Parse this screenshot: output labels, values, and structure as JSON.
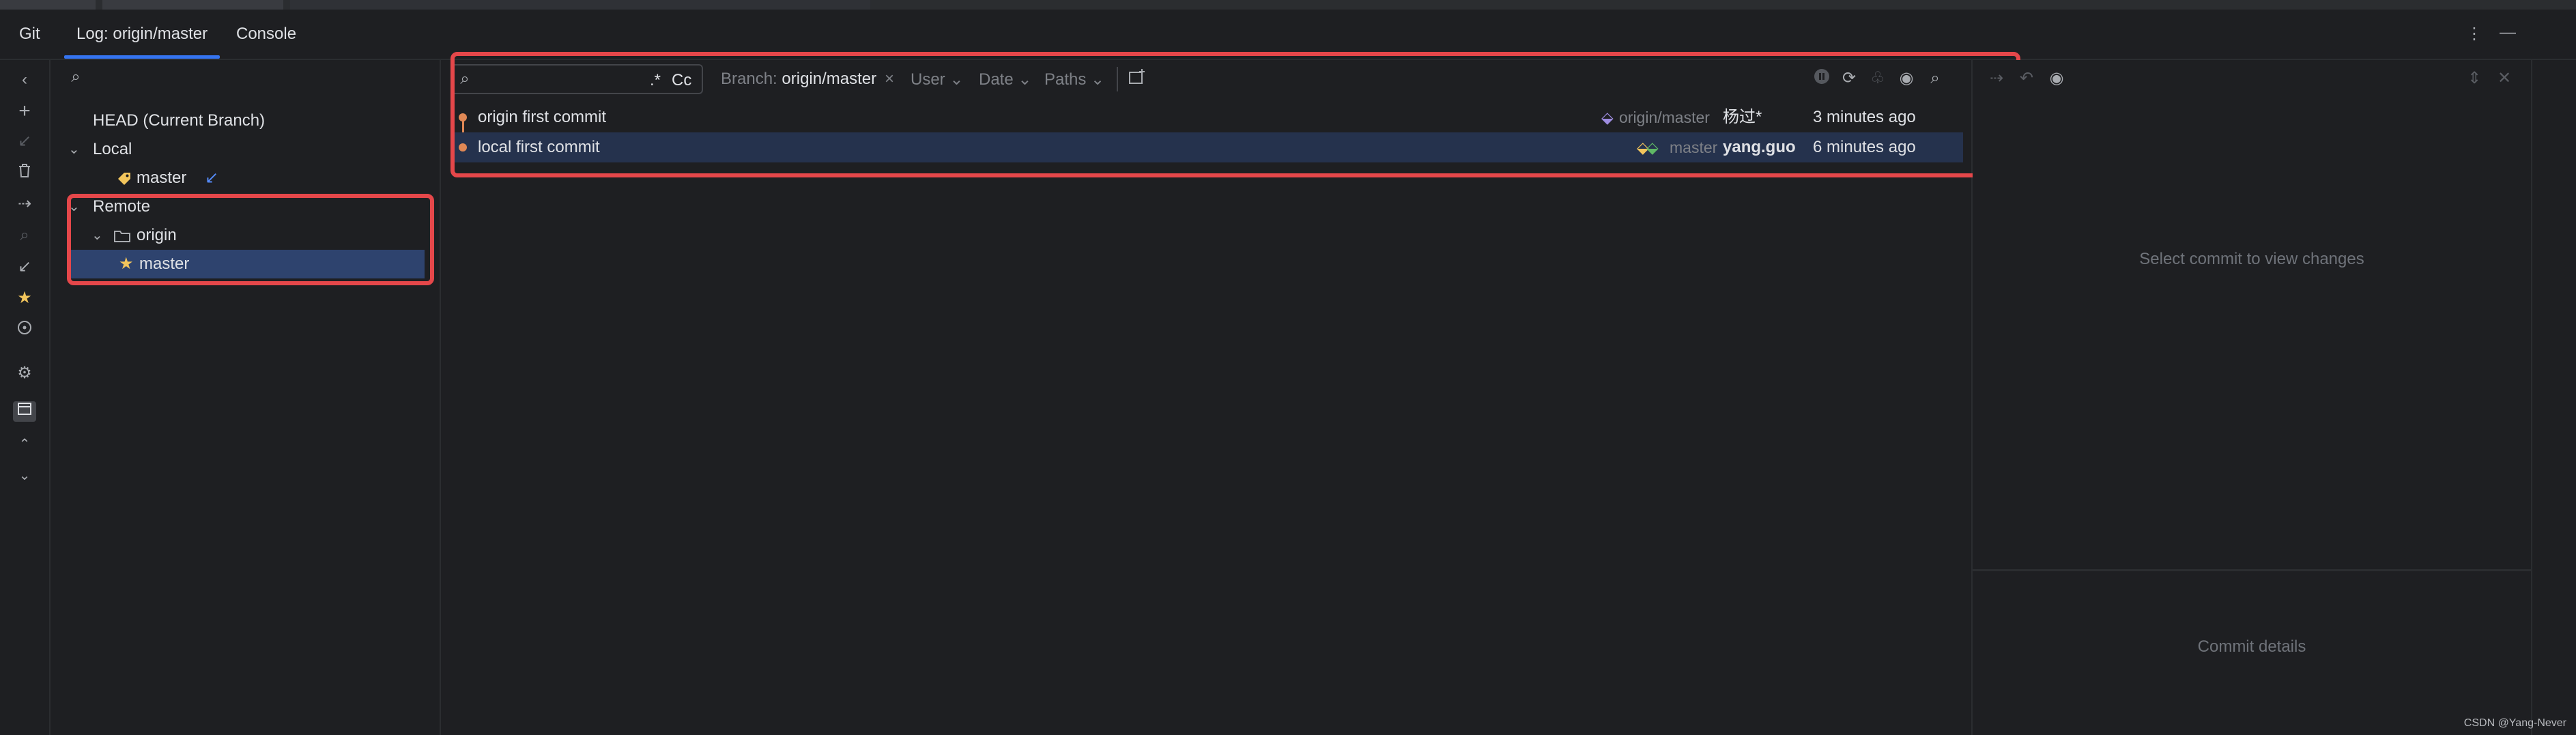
{
  "tabs": [
    {
      "label": "Git"
    },
    {
      "label": "Log: origin/master"
    },
    {
      "label": "Console"
    }
  ],
  "left_toolbar_icons": [
    "chevron-left-icon",
    "plus-icon",
    "update-arrow-icon",
    "trash-icon",
    "merge-icon",
    "search-icon",
    "checkout-icon",
    "star-icon",
    "compass-icon",
    "settings-icon",
    "preview-icon",
    "expand-icon",
    "collapse-icon"
  ],
  "branch_tree": {
    "head": "HEAD (Current Branch)",
    "local_label": "Local",
    "local_master": "master",
    "remote_label": "Remote",
    "origin_label": "origin",
    "remote_master": "master"
  },
  "log": {
    "search_value": "",
    "regex_label": ".*",
    "case_label": "Cc",
    "branch_filter_label": "Branch:",
    "branch_filter_value": "origin/master",
    "user_filter": "User",
    "date_filter": "Date",
    "paths_filter": "Paths",
    "commits": [
      {
        "message": "origin first commit",
        "ref": "origin/master",
        "author": "杨过*",
        "date": "3 minutes ago"
      },
      {
        "message": "local first commit",
        "ref": "master",
        "author": "yang.guo",
        "date": "6 minutes ago"
      }
    ]
  },
  "details": {
    "changes_placeholder": "Select commit to view changes",
    "commit_details_placeholder": "Commit details"
  },
  "watermark": "CSDN @Yang-Never",
  "colors": {
    "accent": "#3574f0",
    "highlight": "#e5474a",
    "graph": "#e08855",
    "tag_yellow": "#f2c55c",
    "tag_green": "#5fb865",
    "tag_purple": "#9e8ce0"
  }
}
